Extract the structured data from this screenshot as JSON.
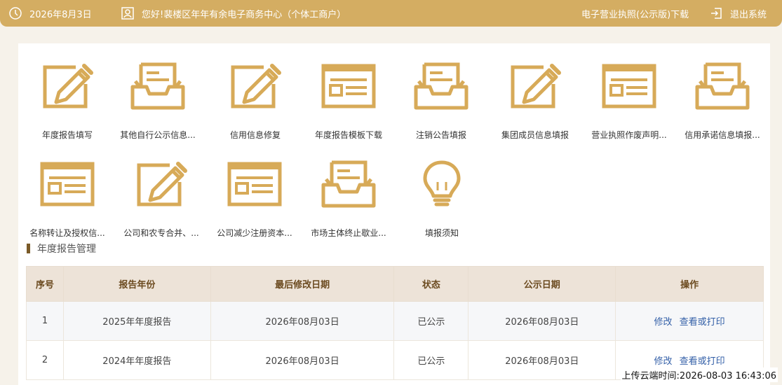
{
  "topbar": {
    "date": "2026年8月3日",
    "greeting": "您好!裴楼区年年有余电子商务中心（个体工商户）",
    "license_download": "电子营业执照(公示版)下载",
    "logout": "退出系统"
  },
  "menu": {
    "row1": [
      {
        "label": "年度报告填写",
        "icon": "pencil-form-icon"
      },
      {
        "label": "其他自行公示信息...",
        "icon": "inbox-tray-icon"
      },
      {
        "label": "信用信息修复",
        "icon": "pencil-form-icon"
      },
      {
        "label": "年度报告模板下载",
        "icon": "template-window-icon"
      },
      {
        "label": "注销公告填报",
        "icon": "inbox-tray-icon"
      },
      {
        "label": "集团成员信息填报",
        "icon": "pencil-form-icon"
      },
      {
        "label": "营业执照作废声明...",
        "icon": "template-window-icon"
      },
      {
        "label": "信用承诺信息填报...",
        "icon": "inbox-tray-icon"
      }
    ],
    "row2": [
      {
        "label": "名称转让及授权信...",
        "icon": "template-window-icon"
      },
      {
        "label": "公司和农专合并、...",
        "icon": "pencil-form-icon"
      },
      {
        "label": "公司减少注册资本...",
        "icon": "template-window-icon"
      },
      {
        "label": "市场主体终止歇业...",
        "icon": "inbox-tray-icon"
      },
      {
        "label": "填报须知",
        "icon": "lightbulb-icon"
      }
    ]
  },
  "section": {
    "title": "年度报告管理"
  },
  "table": {
    "headers": [
      "序号",
      "报告年份",
      "最后修改日期",
      "状态",
      "公示日期",
      "操作"
    ],
    "rows": [
      {
        "index": "1",
        "year": "2025年年度报告",
        "modified": "2026年08月03日",
        "status": "已公示",
        "published": "2026年08月03日",
        "op_edit": "修改",
        "op_view": "查看或打印"
      },
      {
        "index": "2",
        "year": "2024年年度报告",
        "modified": "2026年08月03日",
        "status": "已公示",
        "published": "2026年08月03日",
        "op_edit": "修改",
        "op_view": "查看或打印"
      }
    ]
  },
  "stamp": "上传云端时间:2026-08-03 16:43:06",
  "colors": {
    "brand": "#d4ad62",
    "icon": "#d7aa58",
    "header_text": "#6b4a1f",
    "link": "#3460a8"
  }
}
